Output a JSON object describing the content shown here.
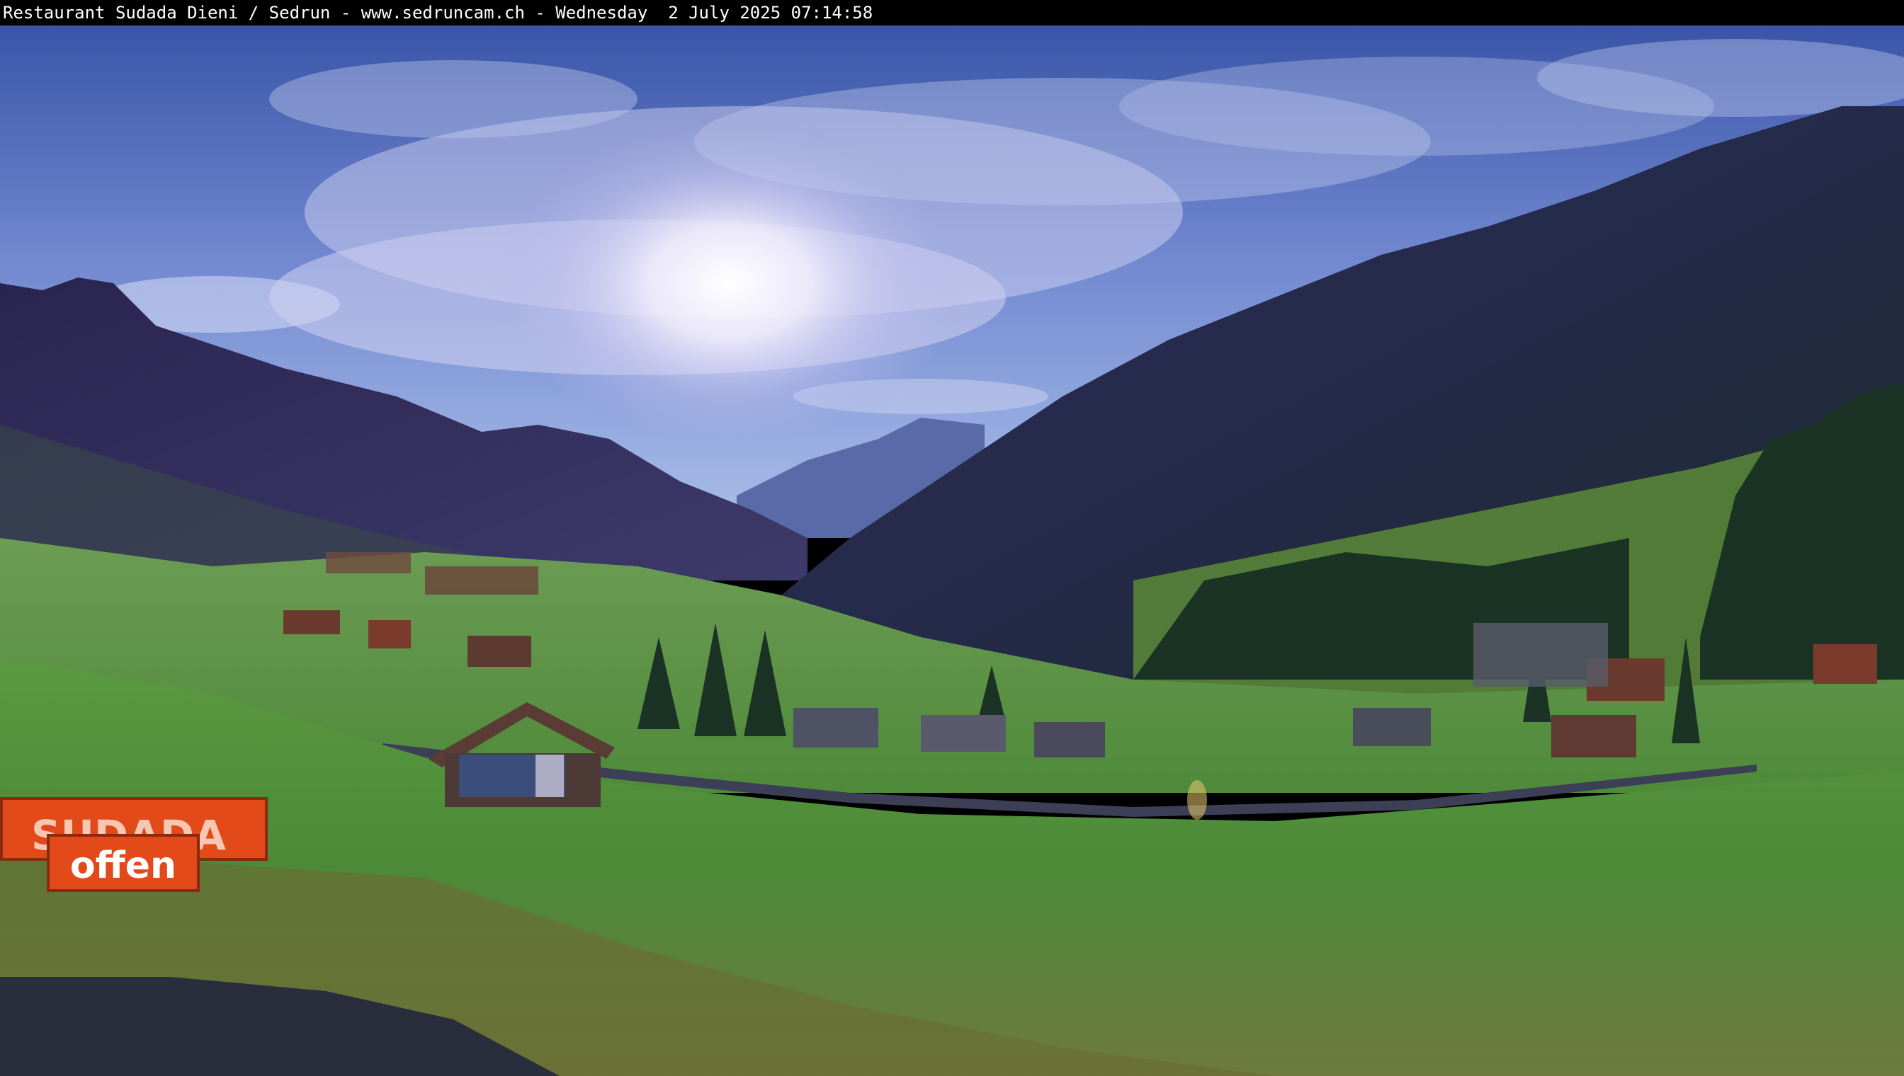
{
  "webcam": {
    "caption": "Restaurant Sudada Dieni / Sedrun - www.sedruncam.ch - Wednesday  2 July 2025 07:14:58"
  },
  "scene": {
    "signs": {
      "restaurant_name": "SUDADA",
      "status": "offen"
    },
    "colors": {
      "sky_top": "#3f5fb0",
      "sky_horizon": "#9fb6e8",
      "meadow": "#4f8a3a",
      "mountain_dark": "#24284a",
      "sign_orange": "#e24a1a"
    }
  }
}
